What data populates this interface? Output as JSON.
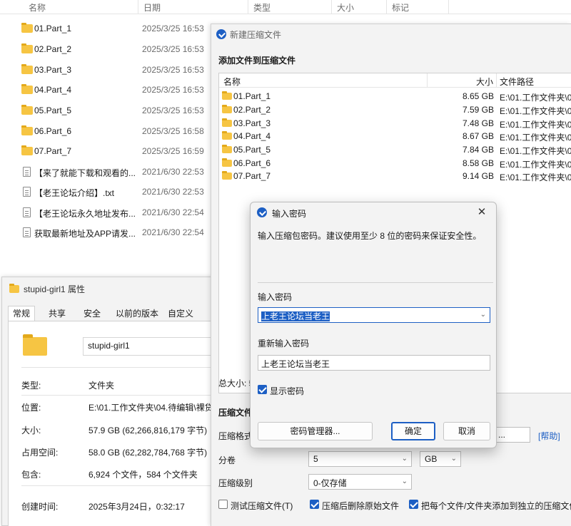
{
  "explorer": {
    "columns": [
      "名称",
      "日期",
      "类型",
      "大小",
      "标记"
    ],
    "rows": [
      {
        "name": "01.Part_1",
        "date": "2025/3/25 16:53",
        "kind": "folder"
      },
      {
        "name": "02.Part_2",
        "date": "2025/3/25 16:53",
        "kind": "folder"
      },
      {
        "name": "03.Part_3",
        "date": "2025/3/25 16:53",
        "kind": "folder"
      },
      {
        "name": "04.Part_4",
        "date": "2025/3/25 16:53",
        "kind": "folder"
      },
      {
        "name": "05.Part_5",
        "date": "2025/3/25 16:53",
        "kind": "folder"
      },
      {
        "name": "06.Part_6",
        "date": "2025/3/25 16:58",
        "kind": "folder"
      },
      {
        "name": "07.Part_7",
        "date": "2025/3/25 16:59",
        "kind": "folder"
      },
      {
        "name": "【来了就能下载和观看的...",
        "date": "2021/6/30 22:53",
        "kind": "file"
      },
      {
        "name": "【老王论坛介绍】.txt",
        "date": "2021/6/30 22:53",
        "kind": "file"
      },
      {
        "name": "【老王论坛永久地址发布...",
        "date": "2021/6/30 22:54",
        "kind": "file"
      },
      {
        "name": "获取最新地址及APP请发...",
        "date": "2021/6/30 22:54",
        "kind": "file"
      }
    ]
  },
  "properties": {
    "title": "stupid-girl1 属性",
    "tabs": [
      "常规",
      "共享",
      "安全",
      "以前的版本",
      "自定义"
    ],
    "folder_name": "stupid-girl1",
    "fields": [
      {
        "key": "类型:",
        "value": "文件夹"
      },
      {
        "key": "位置:",
        "value": "E:\\01.工作文件夹\\04.待编辑\\裸贷"
      },
      {
        "key": "大小:",
        "value": "57.9 GB (62,266,816,179 字节)"
      },
      {
        "key": "占用空间:",
        "value": "58.0 GB (62,282,784,768 字节)"
      },
      {
        "key": "包含:",
        "value": "6,924 个文件，584 个文件夹"
      },
      {
        "key": "创建时间:",
        "value": "2025年3月24日，0:32:17"
      }
    ]
  },
  "archive": {
    "title": "新建压缩文件",
    "heading": "添加文件到压缩文件",
    "columns": [
      "名称",
      "大小",
      "文件路径"
    ],
    "rows": [
      {
        "name": "01.Part_1",
        "size": "8.65 GB",
        "path": "E:\\01.工作文件夹\\0"
      },
      {
        "name": "02.Part_2",
        "size": "7.59 GB",
        "path": "E:\\01.工作文件夹\\0"
      },
      {
        "name": "03.Part_3",
        "size": "7.48 GB",
        "path": "E:\\01.工作文件夹\\0"
      },
      {
        "name": "04.Part_4",
        "size": "8.67 GB",
        "path": "E:\\01.工作文件夹\\0"
      },
      {
        "name": "05.Part_5",
        "size": "7.84 GB",
        "path": "E:\\01.工作文件夹\\0"
      },
      {
        "name": "06.Part_6",
        "size": "8.58 GB",
        "path": "E:\\01.工作文件夹\\0"
      },
      {
        "name": "07.Part_7",
        "size": "9.14 GB",
        "path": "E:\\01.工作文件夹\\0"
      }
    ],
    "total_label": "总大小: 5",
    "section_label": "压缩文件",
    "format_label": "压缩格式",
    "browse_label": "...",
    "help_label": "[帮助]",
    "split_label": "分卷",
    "split_value": "5",
    "split_unit": "GB",
    "level_label": "压缩级别",
    "level_value": "0-仅存储",
    "test_label": "测试压缩文件(T)",
    "test_checked": false,
    "delete_label": "压缩后删除原始文件",
    "delete_checked": true,
    "separate_label": "把每个文件/文件夹添加到独立的压缩文件",
    "separate_checked": true
  },
  "password_dialog": {
    "title": "输入密码",
    "description": "输入压缩包密码。建议使用至少 8 位的密码来保证安全性。",
    "password_label": "输入密码",
    "password_value": "上老王论坛当老王",
    "confirm_label": "重新输入密码",
    "confirm_value": "上老王论坛当老王",
    "show_password_label": "显示密码",
    "show_password_checked": true,
    "manager_button": "密码管理器...",
    "ok_button": "确定",
    "cancel_button": "取消"
  },
  "colors": {
    "accent": "#1d5fc4",
    "folder": "#f6c543"
  }
}
